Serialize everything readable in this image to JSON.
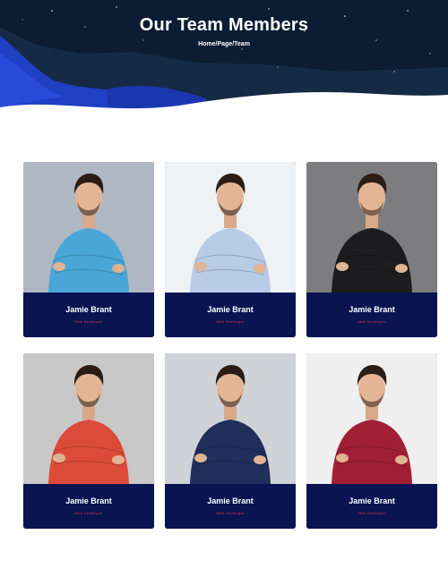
{
  "header": {
    "title": "Our Team Members",
    "breadcrumb": {
      "home": "Home",
      "sep1": "/",
      "page": "Page",
      "sep2": "/",
      "current": "Team"
    }
  },
  "colors": {
    "card_bg": "#0a1450",
    "role_text": "#e8324f",
    "hero_sky": "#0b1c33",
    "hero_mountain": "#1f3fc4"
  },
  "team": [
    {
      "name": "Jamie Brant",
      "role": "Web Developer",
      "shirt": "#4aa5d8",
      "backdrop": "#aeb7c2"
    },
    {
      "name": "Jamie Brant",
      "role": "Web Developer",
      "shirt": "#b8cce4",
      "backdrop": "#eef2f5"
    },
    {
      "name": "Jamie Brant",
      "role": "Web Developer",
      "shirt": "#1c1c1e",
      "backdrop": "#7d7d80"
    },
    {
      "name": "Jamie Brant",
      "role": "Web Developer",
      "shirt": "#dc4b3a",
      "backdrop": "#c8c8c9"
    },
    {
      "name": "Jamie Brant",
      "role": "Web Developer",
      "shirt": "#1f2f5a",
      "backdrop": "#cfd2d6"
    },
    {
      "name": "Jamie Brant",
      "role": "Web Developer",
      "shirt": "#a01f35",
      "backdrop": "#efefef"
    }
  ]
}
